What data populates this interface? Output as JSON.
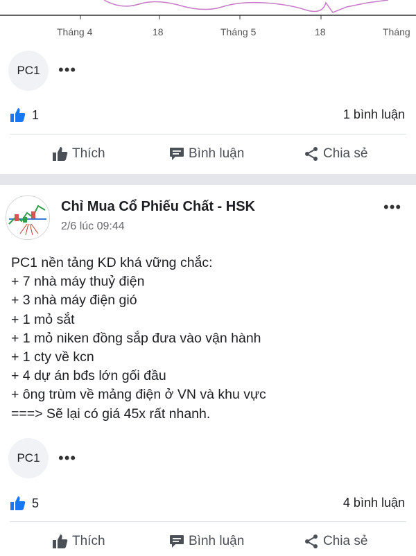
{
  "chart_remnant": {
    "x_labels": [
      "Tháng 4",
      "18",
      "Tháng 5",
      "18",
      "Tháng"
    ],
    "colors": {
      "line": "#c77ac7",
      "baseline": "#333333"
    }
  },
  "post1": {
    "tag": "PC1",
    "like_count": "1",
    "comment_count": "1 bình luận",
    "actions": {
      "like": "Thích",
      "comment": "Bình luận",
      "share": "Chia sẻ"
    }
  },
  "post2": {
    "author": "Chỉ Mua Cổ Phiếu Chất - HSK",
    "time": "2/6 lúc 09:44",
    "lines": [
      "PC1 nền tảng KD khá vững chắc:",
      "+ 7 nhà máy thuỷ điện",
      "+ 3 nhà máy điện gió",
      "+ 1 mỏ sắt",
      "+ 1 mỏ niken đồng sắp đưa vào vận hành",
      "+ 1 cty về kcn",
      "+ 4 dự án bđs lớn gối đầu",
      "+ ông trùm về mảng điện ở VN và khu vực",
      "===> Sẽ lại có giá 45x rất nhanh."
    ],
    "tag": "PC1",
    "like_count": "5",
    "comment_count": "4 bình luận",
    "actions": {
      "like": "Thích",
      "comment": "Bình luận",
      "share": "Chia sẻ"
    }
  },
  "icons": {
    "more": "ellipsis-icon",
    "like_reaction": "thumbs-up-reaction-icon",
    "like": "thumbs-up-icon",
    "comment": "comment-icon",
    "share": "share-icon"
  },
  "colors": {
    "reaction_blue": "#1877f2",
    "action_gray": "#4b4f56",
    "chip_bg": "#f0f2f5",
    "section_gap": "#e4e6eb"
  }
}
